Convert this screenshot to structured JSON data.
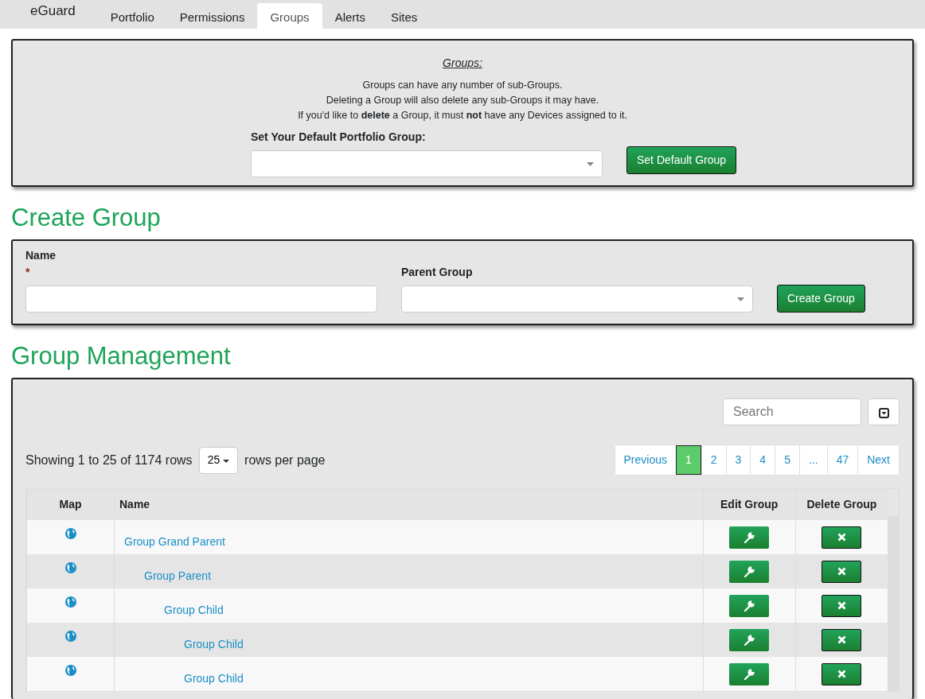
{
  "nav": {
    "brand": "eGuard",
    "tabs": [
      {
        "label": "Portfolio",
        "selected": false
      },
      {
        "label": "Permissions",
        "selected": false
      },
      {
        "label": "Groups",
        "selected": true
      },
      {
        "label": "Alerts",
        "selected": false
      },
      {
        "label": "Sites",
        "selected": false
      }
    ]
  },
  "info_panel": {
    "title": "Groups:",
    "lines": [
      "Groups can have any number of sub-Groups.",
      "Deleting a Group will also delete any sub-Groups it may have.",
      "If you'd like to **delete** a Group, it must **not** have any Devices assigned to it."
    ],
    "default_label": "Set Your Default Portfolio Group:",
    "button": "Set Default Group"
  },
  "create": {
    "heading": "Create Group",
    "name_label": "Name",
    "required_mark": "*",
    "parent_label": "Parent Group",
    "button": "Create Group"
  },
  "management": {
    "heading": "Group Management",
    "search": {
      "placeholder": "Search"
    },
    "showing": "Showing 1 to 25 of 1174 rows",
    "page_size": "25",
    "rows_per_page": "rows per page",
    "pages": [
      {
        "label": "Previous",
        "selected": false
      },
      {
        "label": "1",
        "selected": true
      },
      {
        "label": "2",
        "selected": false
      },
      {
        "label": "3",
        "selected": false
      },
      {
        "label": "4",
        "selected": false
      },
      {
        "label": "5",
        "selected": false
      },
      {
        "label": "...",
        "selected": false
      },
      {
        "label": "47",
        "selected": false
      },
      {
        "label": "Next",
        "selected": false
      }
    ],
    "columns": [
      "Map",
      "Name",
      "Edit Group",
      "Delete Group"
    ],
    "rows": [
      {
        "name": "Group Grand Parent",
        "children": [
          {
            "name": "Group Parent",
            "children": [
              {
                "name": "Group Child",
                "children": [
                  {
                    "name": "Group Child"
                  },
                  {
                    "name": "Group Child"
                  }
                ]
              }
            ]
          }
        ]
      }
    ]
  }
}
